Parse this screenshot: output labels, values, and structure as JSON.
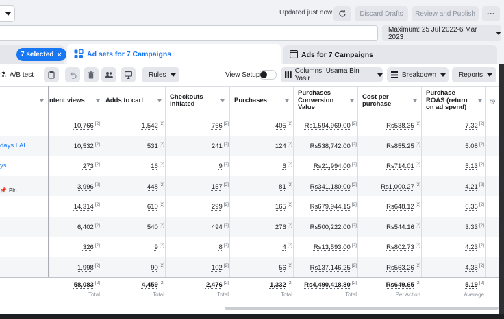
{
  "header": {
    "updated_text": "Updated just now",
    "discard_label": "Discard Drafts",
    "review_label": "Review and Publish",
    "more_label": "···"
  },
  "date_range": {
    "label": "Maximum: 25 Jul 2022-6 Mar 2023"
  },
  "tabs": {
    "selected_chip": "7 selected",
    "adsets_tab": "Ad sets for 7 Campaigns",
    "ads_tab": "Ads for 7 Campaigns"
  },
  "toolbar": {
    "ab_test": "A/B test",
    "rules": "Rules",
    "view_setup": "View Setup",
    "columns": "Columns: Usama Bin Yasir",
    "breakdown": "Breakdown",
    "reports": "Reports"
  },
  "columns": [
    "ntent views",
    "Adds to cart",
    "Checkouts initiated",
    "Purchases",
    "Purchases Conversion Value",
    "Cost per purchase",
    "Purchase ROAS (return on ad spend)"
  ],
  "footnote_mark": "[2]",
  "rows": [
    {
      "name": "",
      "cells": [
        "10,766",
        "1,542",
        "766",
        "405",
        "Rs1,594,969.00",
        "Rs538.35",
        "7.32"
      ]
    },
    {
      "name": "days LAL",
      "cells": [
        "10,532",
        "531",
        "241",
        "124",
        "Rs538,742.00",
        "Rs855.25",
        "5.08"
      ]
    },
    {
      "name": "ys",
      "cells": [
        "273",
        "16",
        "9",
        "6",
        "Rs21,994.00",
        "Rs714.01",
        "5.13"
      ]
    },
    {
      "name": "",
      "pin": "Pin",
      "cells": [
        "3,996",
        "448",
        "157",
        "81",
        "Rs341,180.00",
        "Rs1,000.27",
        "4.21"
      ]
    },
    {
      "name": "",
      "cells": [
        "14,314",
        "610",
        "299",
        "165",
        "Rs679,944.15",
        "Rs648.12",
        "6.36"
      ]
    },
    {
      "name": "",
      "cells": [
        "6,402",
        "540",
        "494",
        "276",
        "Rs500,222.00",
        "Rs544.16",
        "3.33"
      ]
    },
    {
      "name": "",
      "cells": [
        "326",
        "9",
        "8",
        "4",
        "Rs13,593.00",
        "Rs802.73",
        "4.23"
      ]
    },
    {
      "name": "",
      "cells": [
        "1,998",
        "90",
        "102",
        "56",
        "Rs137,146.25",
        "Rs563.26",
        "4.35"
      ]
    }
  ],
  "totals": [
    {
      "value": "58,083",
      "label": "Total"
    },
    {
      "value": "4,459",
      "label": "Total"
    },
    {
      "value": "2,476",
      "label": "Total"
    },
    {
      "value": "1,332",
      "label": "Total"
    },
    {
      "value": "Rs4,490,418.80",
      "label": "Total"
    },
    {
      "value": "Rs649.65",
      "label": "Per Action"
    },
    {
      "value": "5.19",
      "label": "Average"
    }
  ],
  "colors": {
    "accent": "#1877f2",
    "background": "#f0f2f5"
  }
}
